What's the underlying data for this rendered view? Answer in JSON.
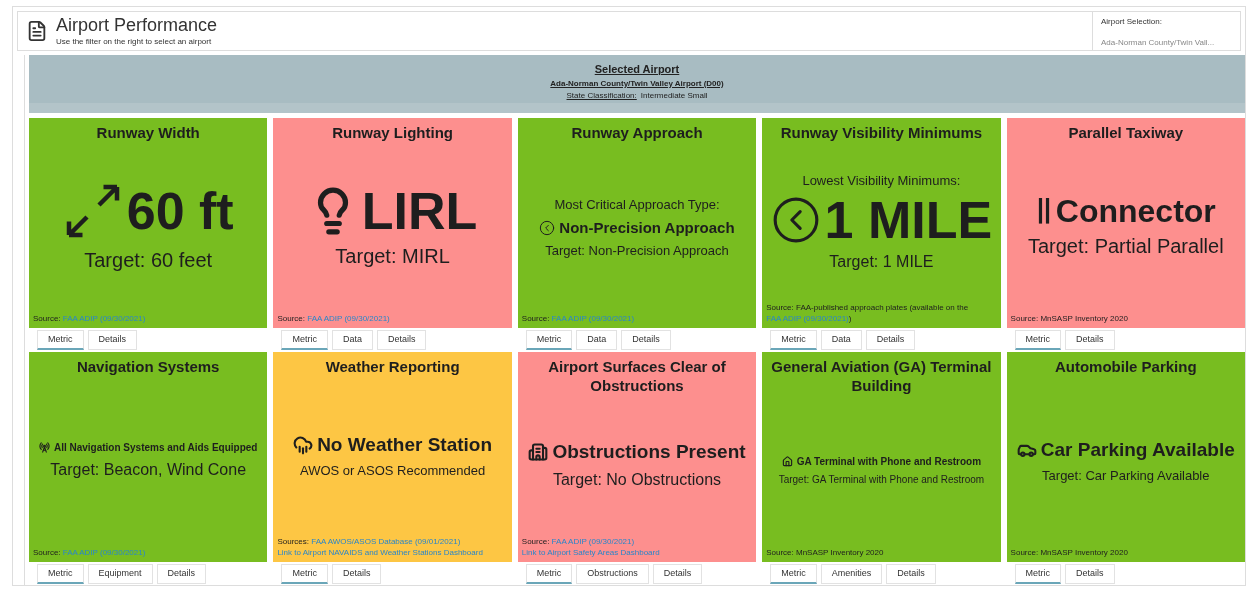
{
  "header": {
    "title": "Airport Performance",
    "subtitle": "Use the filter on the right to select an airport",
    "selection_label": "Airport Selection:",
    "selection_value": "Ada-Norman County/Twin Vall..."
  },
  "banner": {
    "heading": "Selected Airport",
    "airport": "Ada-Norman County/Twin Valley Airport (D00)",
    "classification_label": "State Classification:",
    "classification_value": "Intermediate Small"
  },
  "cards": [
    {
      "title": "Runway Width",
      "color": "#78bd20",
      "main": "60 ft",
      "target": "Target: 60 feet",
      "source": [
        [
          {
            "text": "Source: ",
            "kind": "text"
          },
          {
            "text": "FAA ADIP (09/30/2021)",
            "kind": "link"
          }
        ]
      ],
      "tabs": [
        {
          "label": "Metric",
          "selected": true
        },
        {
          "label": "Details",
          "selected": false
        }
      ]
    },
    {
      "title": "Runway Lighting",
      "color": "#fd8f8e",
      "main": "LIRL",
      "target": "Target: MIRL",
      "source": [
        [
          {
            "text": "Source: ",
            "kind": "text"
          },
          {
            "text": "FAA ADIP (09/30/2021)",
            "kind": "link"
          }
        ]
      ],
      "tabs": [
        {
          "label": "Metric",
          "selected": true
        },
        {
          "label": "Data",
          "selected": false
        },
        {
          "label": "Details",
          "selected": false
        }
      ]
    },
    {
      "title": "Runway Approach",
      "color": "#78bd20",
      "pre": "Most Critical Approach Type:",
      "main": "Non-Precision Approach",
      "target": "Target: Non-Precision Approach",
      "source": [
        [
          {
            "text": "Source: ",
            "kind": "text"
          },
          {
            "text": "FAA ADIP (09/30/2021)",
            "kind": "link"
          }
        ]
      ],
      "tabs": [
        {
          "label": "Metric",
          "selected": true
        },
        {
          "label": "Data",
          "selected": false
        },
        {
          "label": "Details",
          "selected": false
        }
      ]
    },
    {
      "title": "Runway Visibility Minimums",
      "color": "#78bd20",
      "pre": "Lowest Visibility Minimums:",
      "main": "1 MILE",
      "target": "Target: 1 MILE",
      "source": [
        [
          {
            "text": "Source: FAA-published approach plates (available on the ",
            "kind": "text"
          },
          {
            "text": "FAA ADIP (09/30/2021)",
            "kind": "link"
          },
          {
            "text": ")",
            "kind": "text"
          }
        ]
      ],
      "tabs": [
        {
          "label": "Metric",
          "selected": true
        },
        {
          "label": "Data",
          "selected": false
        },
        {
          "label": "Details",
          "selected": false
        }
      ]
    },
    {
      "title": "Parallel Taxiway",
      "color": "#fd8f8e",
      "main": "Connector",
      "target": "Target: Partial Parallel",
      "source": [
        [
          {
            "text": "Source: MnSASP Inventory 2020",
            "kind": "text"
          }
        ]
      ],
      "tabs": [
        {
          "label": "Metric",
          "selected": true
        },
        {
          "label": "Details",
          "selected": false
        }
      ]
    },
    {
      "title": "Navigation Systems",
      "color": "#78bd20",
      "main": "All Navigation Systems and Aids Equipped",
      "target": "Target: Beacon, Wind Cone",
      "source": [
        [
          {
            "text": "Source: ",
            "kind": "text"
          },
          {
            "text": "FAA ADIP (09/30/2021)",
            "kind": "link"
          }
        ]
      ],
      "tabs": [
        {
          "label": "Metric",
          "selected": true
        },
        {
          "label": "Equipment",
          "selected": false
        },
        {
          "label": "Details",
          "selected": false
        }
      ]
    },
    {
      "title": "Weather Reporting",
      "color": "#fdc644",
      "main": "No Weather Station",
      "target": "AWOS or ASOS Recommended",
      "source": [
        [
          {
            "text": "Sources: ",
            "kind": "text"
          },
          {
            "text": "FAA AWOS/ASOS Database (09/01/2021)",
            "kind": "link"
          }
        ],
        [
          {
            "text": "Link to Airport NAVAIDS and Weather Stations Dashboard",
            "kind": "link"
          }
        ]
      ],
      "tabs": [
        {
          "label": "Metric",
          "selected": true
        },
        {
          "label": "Details",
          "selected": false
        }
      ]
    },
    {
      "title": "Airport Surfaces Clear of Obstructions",
      "color": "#fd8f8e",
      "main": "Obstructions Present",
      "target": "Target: No Obstructions",
      "source": [
        [
          {
            "text": "Source: ",
            "kind": "text"
          },
          {
            "text": "FAA ADIP (09/30/2021)",
            "kind": "link"
          }
        ],
        [
          {
            "text": "Link to Airport Safety Areas Dashboard",
            "kind": "link"
          }
        ]
      ],
      "tabs": [
        {
          "label": "Metric",
          "selected": true
        },
        {
          "label": "Obstructions",
          "selected": false
        },
        {
          "label": "Details",
          "selected": false
        }
      ]
    },
    {
      "title": "General Aviation (GA) Terminal Building",
      "color": "#78bd20",
      "main": "GA Terminal with Phone and Restroom",
      "target": "Target: GA Terminal with Phone and Restroom",
      "source": [
        [
          {
            "text": "Source: MnSASP Inventory 2020",
            "kind": "text"
          }
        ]
      ],
      "tabs": [
        {
          "label": "Metric",
          "selected": true
        },
        {
          "label": "Amenities",
          "selected": false
        },
        {
          "label": "Details",
          "selected": false
        }
      ]
    },
    {
      "title": "Automobile Parking",
      "color": "#78bd20",
      "main": "Car Parking Available",
      "target": "Target: Car Parking Available",
      "source": [
        [
          {
            "text": "Source: MnSASP Inventory 2020",
            "kind": "text"
          }
        ]
      ],
      "tabs": [
        {
          "label": "Metric",
          "selected": true
        },
        {
          "label": "Details",
          "selected": false
        }
      ]
    }
  ]
}
